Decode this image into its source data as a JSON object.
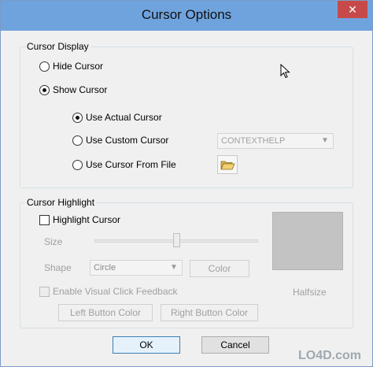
{
  "window": {
    "title": "Cursor Options",
    "close_glyph": "✕"
  },
  "display_group": {
    "label": "Cursor Display",
    "hide_label": "Hide Cursor",
    "show_label": "Show Cursor",
    "actual_label": "Use Actual Cursor",
    "custom_label": "Use Custom Cursor",
    "from_file_label": "Use Cursor From File",
    "custom_select_value": "CONTEXTHELP",
    "selected_visibility": "show",
    "selected_source": "actual"
  },
  "highlight_group": {
    "label": "Cursor Highlight",
    "highlight_label": "Highlight Cursor",
    "size_label": "Size",
    "shape_label": "Shape",
    "shape_value": "Circle",
    "color_button": "Color",
    "halfsize_label": "Halfsize",
    "visual_click_label": "Enable Visual Click Feedback",
    "left_button_color": "Left Button Color",
    "right_button_color": "Right Button Color",
    "size_level": 0.5
  },
  "footer": {
    "ok_label": "OK",
    "cancel_label": "Cancel"
  },
  "watermark": {
    "text": "LO4D.com"
  },
  "colors": {
    "titlebar": "#6fa3de",
    "close": "#c74a4a",
    "preview": "#c3c3c3"
  }
}
